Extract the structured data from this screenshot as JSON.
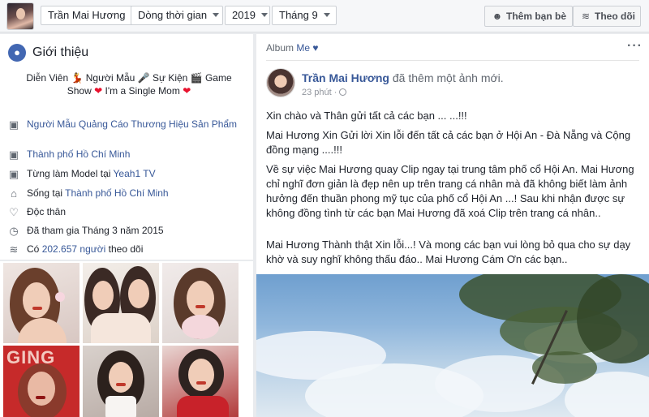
{
  "topbar": {
    "profile_name": "Trần Mai Hương",
    "timeline": "Dòng thời gian",
    "year": "2019",
    "month": "Tháng 9",
    "add_friend": "Thêm bạn bè",
    "follow": "Theo dõi",
    "add_friend_icon": "person-plus-icon",
    "follow_icon": "rss-icon"
  },
  "intro": {
    "title": "Giới thiệu",
    "bio_line1": "Diễn Viên 💃 Người Mẫu 🎤 Sự Kiện 🎬 Game",
    "bio_line2a": "Show",
    "bio_line2b": "I'm a Single Mom",
    "items": [
      {
        "icon": "briefcase-icon",
        "link": "Người Mẫu Quảng Cáo Thương Hiệu Sản Phẩm"
      },
      {
        "icon": "briefcase-icon",
        "link": "Thành phố Hồ Chí Minh"
      },
      {
        "icon": "briefcase-icon",
        "prefix": "Từng làm Model tại",
        "link": "Yeah1 TV"
      },
      {
        "icon": "home-icon",
        "prefix": "Sống tại",
        "link": "Thành phố Hồ Chí Minh"
      },
      {
        "icon": "heart-outline-icon",
        "text": "Độc thân"
      },
      {
        "icon": "clock-icon",
        "text": "Đã tham gia Tháng 3 năm 2015"
      },
      {
        "icon": "rss-icon",
        "prefix": "Có",
        "link": "202.657 người",
        "suffix": "theo dõi"
      }
    ]
  },
  "photo_overlay_text": "GING",
  "post": {
    "album_label": "Album",
    "album_owner": "Me",
    "author": "Trần Mai Hương",
    "action": "đã thêm một ảnh mới.",
    "time": "23 phút",
    "lines": [
      "Xin chào và Thân gửi tất cả các bạn ... ...!!!",
      "Mai Hương Xin Gửi lời Xin lỗi đến tất cả các bạn ở Hội An - Đà Nẵng và Cộng đồng mạng ....!!!",
      "Về sự việc Mai Hương quay Clip ngay tại trung tâm phố cổ Hội An. Mai Hương chỉ nghĩ đơn giản là đẹp nên up trên trang cá nhân mà đã không biết làm ảnh hưởng đến thuần phong mỹ tục của phố cổ Hội An ...! Sau khi nhận được sự không đồng tình từ các bạn Mai Hương đã xoá Clip trên trang cá nhân..",
      "Mai Hương Thành thật Xin lỗi...! Và mong các bạn vui lòng bỏ qua cho sự dạy khờ và suy nghĩ không thấu đáo.. Mai Hương Cám Ơn các bạn.."
    ]
  }
}
